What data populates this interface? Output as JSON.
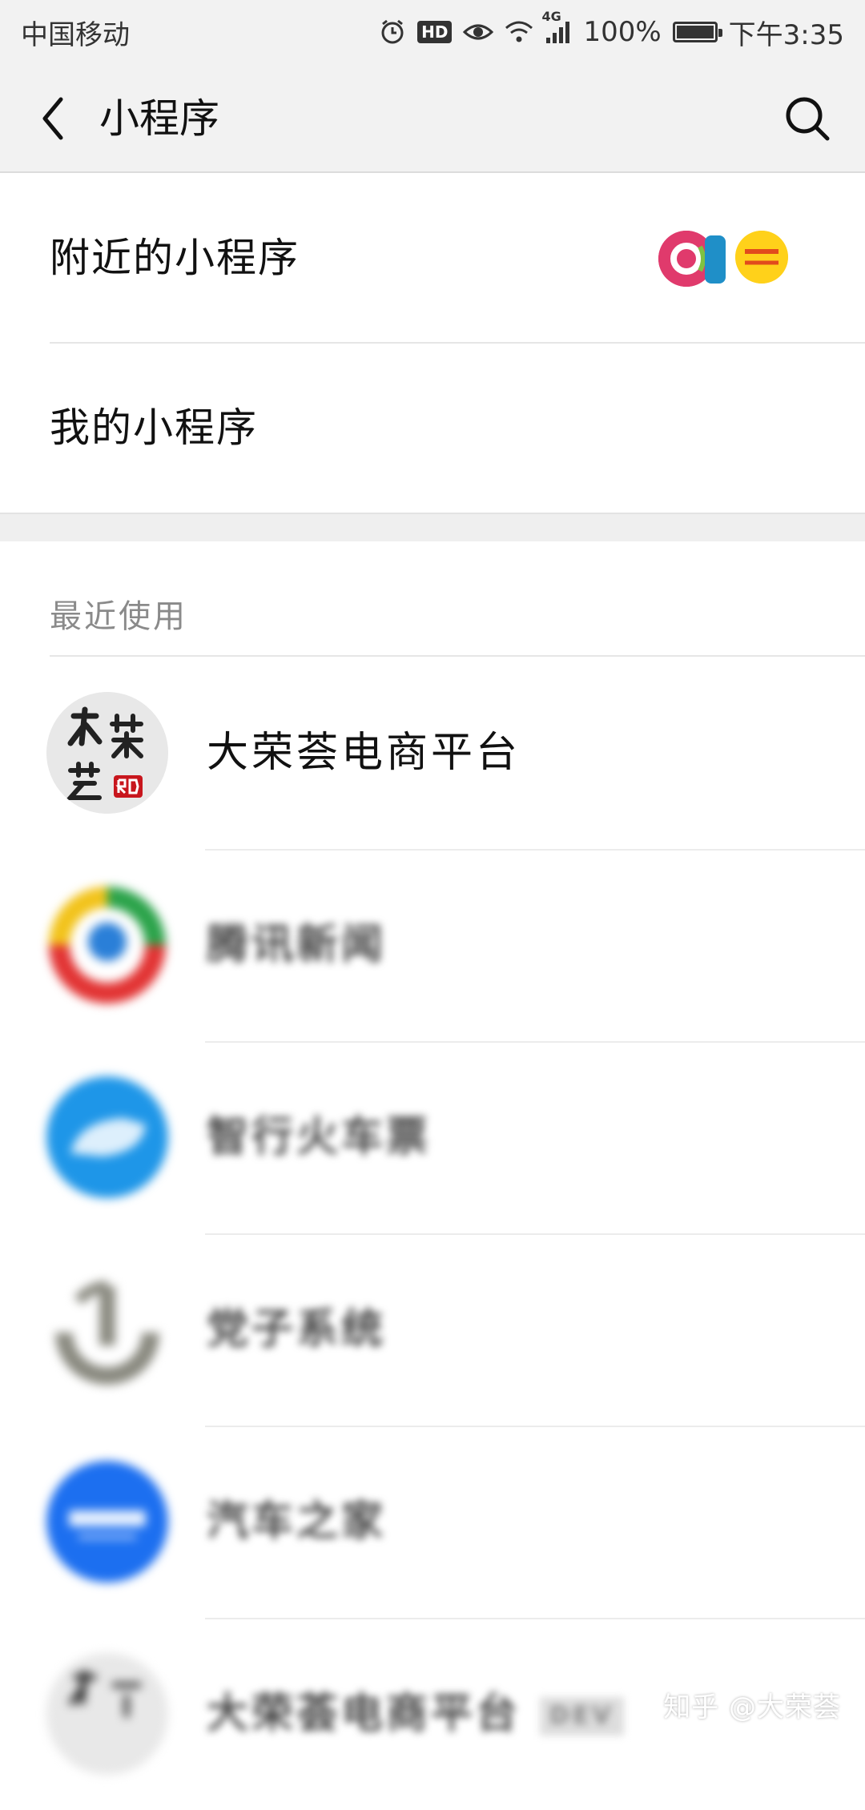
{
  "status_bar": {
    "carrier": "中国移动",
    "network": "4G",
    "battery": "100%",
    "time": "下午3:35",
    "hd_badge": "HD",
    "icons": [
      "alarm-icon",
      "hd-icon",
      "eye-icon",
      "wifi-icon",
      "signal-icon",
      "battery-icon"
    ]
  },
  "nav": {
    "title": "小程序",
    "back_icon": "chevron-left-icon",
    "search_icon": "search-icon"
  },
  "menu": {
    "nearby_label": "附近的小程序",
    "mine_label": "我的小程序"
  },
  "recent": {
    "header": "最近使用",
    "items": [
      {
        "name": "大荣荟电商平台",
        "blurred": false,
        "icon": "darongguo-logo"
      },
      {
        "name": "腾讯新闻",
        "blurred": true,
        "icon": "tencent-news-logo"
      },
      {
        "name": "智行火车票",
        "blurred": true,
        "icon": "train-ticket-logo"
      },
      {
        "name": "党子系统",
        "blurred": true,
        "icon": "system-logo"
      },
      {
        "name": "汽车之家",
        "blurred": true,
        "icon": "autohome-logo"
      },
      {
        "name": "大荣荟电商平台",
        "blurred": true,
        "icon": "darongguo-logo",
        "tag": "DEV"
      }
    ]
  },
  "watermark": "知乎 @大荣荟",
  "colors": {
    "background": "#ffffff",
    "nav_background": "#f2f2f2",
    "section_gap": "#efefef",
    "secondary_text": "#8a8a8a"
  }
}
